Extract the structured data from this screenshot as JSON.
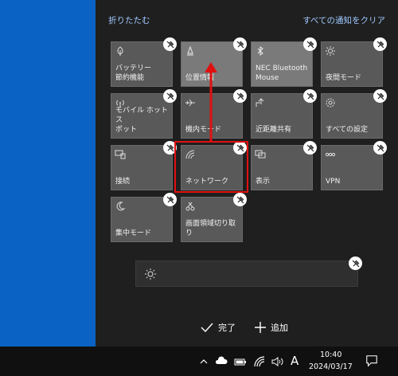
{
  "header": {
    "collapse_label": "折りたたむ",
    "clear_all_label": "すべての通知をクリア"
  },
  "tiles": [
    {
      "label": "バッテリー\n節約機能",
      "icon": "leaf-icon",
      "active": false
    },
    {
      "label": "位置情報",
      "icon": "location-icon",
      "active": true
    },
    {
      "label": "NEC Bluetooth\nMouse",
      "icon": "bluetooth-icon",
      "active": true
    },
    {
      "label": "夜間モード",
      "icon": "sun-icon",
      "active": false
    },
    {
      "label": "モバイル ホットス\nポット",
      "icon": "hotspot-icon",
      "active": false
    },
    {
      "label": "機内モード",
      "icon": "airplane-icon",
      "active": false
    },
    {
      "label": "近距離共有",
      "icon": "share-icon",
      "active": false
    },
    {
      "label": "すべての設定",
      "icon": "gear-icon",
      "active": false
    },
    {
      "label": "接続",
      "icon": "connect-icon",
      "active": false
    },
    {
      "label": "ネットワーク",
      "icon": "network-icon",
      "active": false
    },
    {
      "label": "表示",
      "icon": "display-icon",
      "active": false
    },
    {
      "label": "VPN",
      "icon": "vpn-icon",
      "active": false
    },
    {
      "label": "集中モード",
      "icon": "moon-icon",
      "active": false
    },
    {
      "label": "画面領域切り取\nり",
      "icon": "snip-icon",
      "active": false
    }
  ],
  "footer": {
    "done_label": "完了",
    "add_label": "追加"
  },
  "taskbar": {
    "ime_label": "A",
    "time": "10:40",
    "date": "2024/03/17"
  },
  "colors": {
    "accent_link": "#9fc8ff",
    "highlight": "#e01010",
    "desktop": "#0a63c4"
  }
}
